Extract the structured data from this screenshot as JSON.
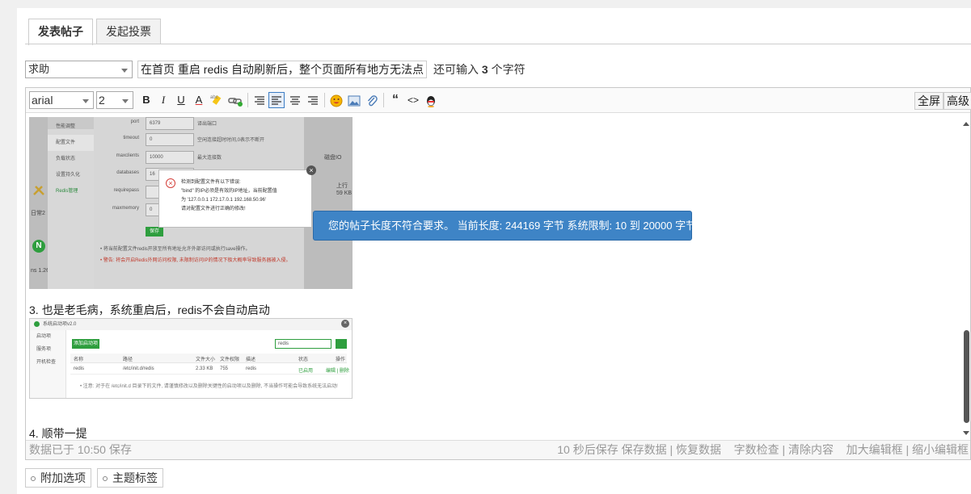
{
  "tabs": [
    {
      "label": "发表帖子",
      "active": true
    },
    {
      "label": "发起投票",
      "active": false
    }
  ],
  "title_row": {
    "category": "求助",
    "subject": "在首页 重启 redis 自动刷新后，整个页面所有地方无法点",
    "remain_prefix": "还可输入 ",
    "remain_count": "3",
    "remain_suffix": " 个字符"
  },
  "toolbar": {
    "font": "arial",
    "size": "2",
    "buttons": [
      {
        "icon": "bold-icon",
        "label": "B"
      },
      {
        "icon": "italic-icon",
        "label": "I"
      },
      {
        "icon": "underline-icon",
        "label": "U"
      },
      {
        "icon": "font-color-icon",
        "label": "A"
      },
      {
        "icon": "highlight-icon",
        "label": "abc"
      },
      {
        "icon": "link-icon",
        "label": ""
      },
      {
        "icon": "align-left-icon",
        "label": ""
      },
      {
        "icon": "align-center-icon",
        "label": ""
      },
      {
        "icon": "align-right-icon",
        "label": ""
      },
      {
        "icon": "align-justify-icon",
        "label": ""
      },
      {
        "icon": "smiley-icon",
        "label": ""
      },
      {
        "icon": "image-icon",
        "label": ""
      },
      {
        "icon": "attachment-icon",
        "label": ""
      },
      {
        "icon": "quote-icon",
        "label": "“"
      },
      {
        "icon": "code-icon",
        "label": "<>"
      },
      {
        "icon": "qq-icon",
        "label": ""
      }
    ],
    "fullscreen": "全屏",
    "advanced": "高级"
  },
  "content": {
    "screenshot1": {
      "menu": [
        "性能调整",
        "配置文件",
        "负载状态",
        "设置持久化",
        "Redis管理"
      ],
      "fields": [
        {
          "label": "port",
          "value": "6379",
          "note": "译出端口"
        },
        {
          "label": "timeout",
          "value": "0",
          "note": "空闲连接超时时间,0表示不断开"
        },
        {
          "label": "maxclients",
          "value": "10000",
          "note": "最大连接数"
        },
        {
          "label": "databases",
          "value": "16",
          "note": ""
        },
        {
          "label": "requirepass",
          "value": "",
          "note": ""
        },
        {
          "label": "maxmemory",
          "value": "0",
          "note": ""
        }
      ],
      "save": "保存",
      "note1": "• 将当前配置文件redis开放至所有地址允许外部访问或执行save操作。",
      "note2": "• 警告: 将会开启Redis外网访问权限, 未限制访问IP的情况下极大概率导致服务器被入侵。",
      "dialog_lines": [
        "检测到配置文件有以下错误:",
        "\"bind\" 的IP必须是有效的IP地址，当前配置值",
        "为 '127.0.0.1 172.17.0.1 192.168.50.96'",
        "请对配置文件进行正确的修改!"
      ],
      "right_labels": [
        "磁盘IO",
        "上行",
        "59 KB"
      ],
      "left_labels": [
        "日常2",
        "ns 1.26."
      ]
    },
    "toast": "您的帖子长度不符合要求。 当前长度: 244169 字节 系统限制: 10 到 20000 字节",
    "para3": "3. 也是老毛病，系统重启后，redis不会自动启动",
    "screenshot2": {
      "title": "系统启动项v2.0",
      "side": [
        "启动项",
        "服务项",
        "开机检查"
      ],
      "add_button": "添加启动项",
      "search_value": "redis",
      "headers": [
        "名称",
        "路径",
        "文件大小",
        "文件权限",
        "描述",
        "状态",
        "操作"
      ],
      "row": [
        "redis",
        "/etc/init.d/redis",
        "2.33 KB",
        "755",
        "redis",
        "已启用",
        "编辑 | 删除"
      ],
      "footer": "• 注意: 对于在 /etc/init.d 目录下的文件, 请谨慎修改以及删除关键性的启动项以及删除, 不当操作可能会导致系统无法启动!"
    },
    "para4": "4. 顺带一提"
  },
  "statusbar": {
    "saved": "数据已于 10:50 保存",
    "autosave": "10 秒后保存",
    "save_data": "保存数据",
    "restore_data": "恢复数据",
    "word_check": "字数检查",
    "clear": "清除内容",
    "enlarge": "加大编辑框",
    "shrink": "缩小编辑框"
  },
  "bottom": {
    "extra_options": "附加选项",
    "tags": "主题标签"
  }
}
